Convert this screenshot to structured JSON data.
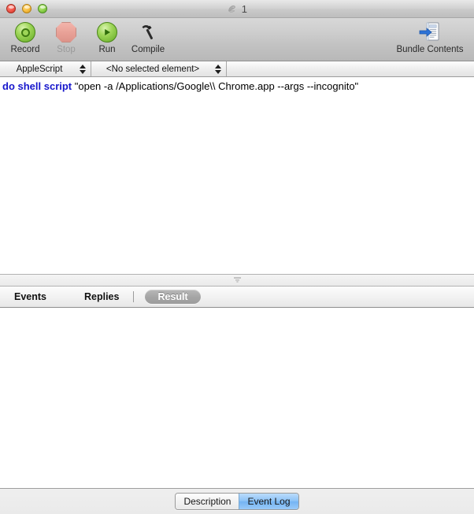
{
  "window": {
    "title": "1",
    "title_icon": "applescript-document-icon",
    "controls": {
      "close": "close-button",
      "minimize": "minimize-button",
      "zoom": "zoom-button"
    }
  },
  "toolbar": {
    "items": [
      {
        "label": "Record",
        "icon": "record-icon",
        "enabled": true
      },
      {
        "label": "Stop",
        "icon": "stop-icon",
        "enabled": false
      },
      {
        "label": "Run",
        "icon": "run-icon",
        "enabled": true
      },
      {
        "label": "Compile",
        "icon": "hammer-icon",
        "enabled": true
      }
    ],
    "bundle": {
      "label": "Bundle Contents",
      "icon": "bundle-contents-icon"
    }
  },
  "popups": {
    "language": {
      "value": "AppleScript",
      "icon": "stepper-arrows-icon"
    },
    "element": {
      "value": "<No selected element>",
      "icon": "stepper-arrows-icon"
    }
  },
  "editor": {
    "lines": [
      {
        "keyword": "do shell script",
        "string": " \"open -a /Applications/Google\\\\ Chrome.app --args --incognito\""
      }
    ]
  },
  "splitter": {
    "icon": "resize-grip-icon"
  },
  "log_tabs": {
    "events": "Events",
    "replies": "Replies",
    "result": "Result",
    "selected": "Result"
  },
  "result_pane": {
    "content": ""
  },
  "bottom_bar": {
    "segments": [
      {
        "label": "Description",
        "selected": false
      },
      {
        "label": "Event Log",
        "selected": true
      }
    ]
  },
  "colors": {
    "keyword_blue": "#1616cc",
    "selection_blue": "#8cc2f6",
    "toolbar_gray": "#c3c3c3",
    "pill_gray": "#a6a6a6"
  }
}
